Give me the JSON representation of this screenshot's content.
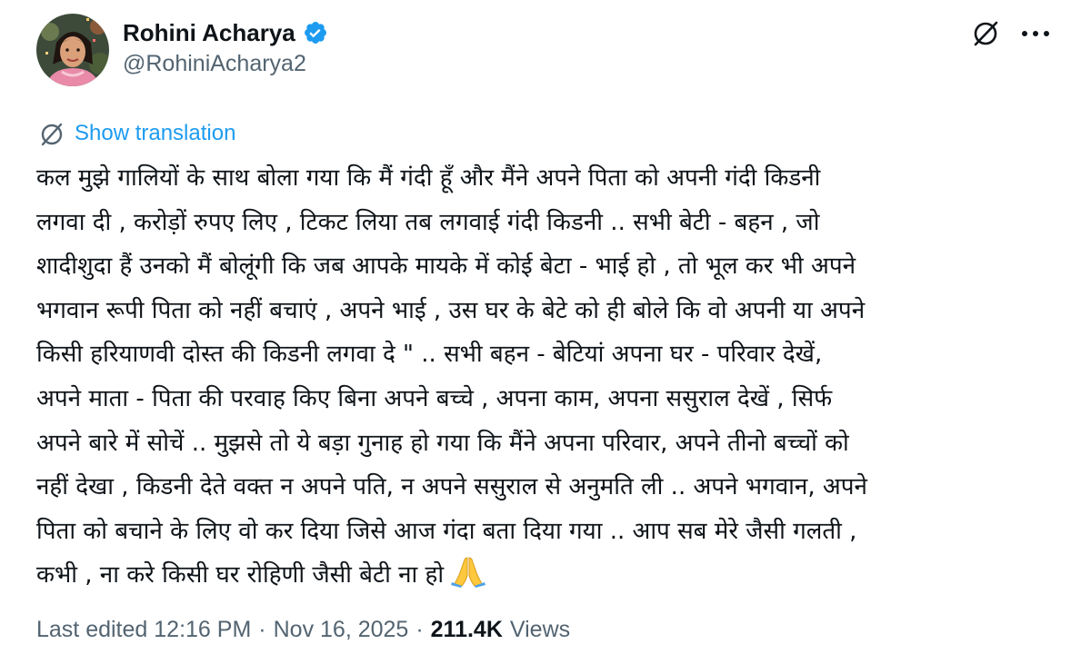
{
  "author": {
    "display_name": "Rohini Acharya",
    "handle": "@RohiniAcharya2",
    "verified": true,
    "verified_color": "#1d9bf0",
    "avatar_icon": "profile-photo"
  },
  "header_actions": {
    "grok_icon": "grok-icon",
    "more_icon": "more-dots-icon"
  },
  "translation": {
    "label": "Show translation",
    "icon": "translate-icon",
    "accent": "#1d9bf0"
  },
  "tweet": {
    "lines": [
      "कल मुझे गालियों के साथ बोला गया कि मैं गंदी हूँ और मैंने अपने  पिता को अपनी गंदी किडनी",
      "लगवा दी , करोड़ों रुपए लिए , टिकट लिया तब लगवाई गंदी किडनी .. सभी बेटी - बहन , जो",
      "शादीशुदा हैं उनको मैं बोलूंगी कि जब आपके मायके में कोई बेटा - भाई हो , तो भूल कर भी अपने",
      "भगवान रूपी पिता को नहीं बचाएं , अपने भाई , उस घर के बेटे को ही बोले कि वो अपनी या अपने",
      "किसी हरियाणवी  दोस्त की किडनी लगवा दे \" .. सभी बहन - बेटियां अपना घर - परिवार देखें,",
      "अपने माता - पिता की परवाह किए बिना अपने बच्चे , अपना काम, अपना ससुराल देखें , सिर्फ",
      "अपने बारे में सोचें ..  मुझसे तो ये बड़ा गुनाह हो गया कि मैंने अपना परिवार, अपने तीनो बच्चों को",
      "नहीं देखा , किडनी देते वक्त न अपने पति, न अपने ससुराल से अनुमति ली .. अपने भगवान, अपने",
      "पिता को बचाने के लिए वो कर दिया जिसे आज गंदा बता दिया गया .. आप सब मेरे जैसी गलती ,",
      "कभी , ना करे किसी घर रोहिणी जैसी बेटी ना हो"
    ],
    "emoji": "folded-hands-emoji"
  },
  "meta": {
    "edited_label": "Last edited 12:16 PM",
    "separator": "·",
    "date": "Nov 16, 2025",
    "views_count": "211.4K",
    "views_label": "Views"
  },
  "colors": {
    "text_primary": "#0f1419",
    "text_secondary": "#536471",
    "accent": "#1d9bf0"
  }
}
